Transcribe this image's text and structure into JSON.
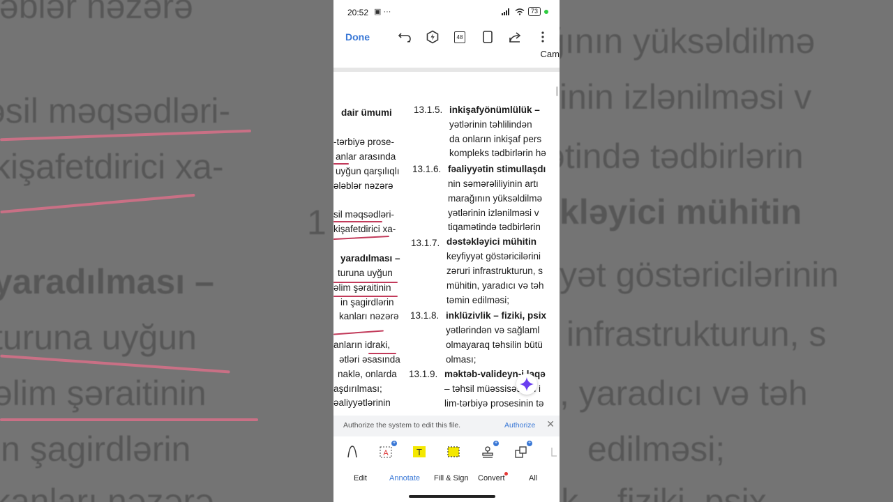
{
  "background": {
    "left_lines": [
      "ələblər nəzərə",
      "əsil məqsədləri-",
      "kişafetdirici xa-",
      "1",
      "yaradılması –",
      "turuna uyğun",
      "əlim şəraitinin",
      "in şagirdlərin",
      "kanları nəzərə"
    ],
    "right_lines": [
      "ğının yüksəldilmə",
      "inin izlənilməsi v",
      "ətində tədbirlərin",
      "kləyici mühitin",
      "yət göstəricilərinin",
      "infrastrukturun, s",
      ", yaradıcı və təh",
      "edilməsi;",
      "lik – fiziki, psix"
    ]
  },
  "status_bar": {
    "time": "20:52",
    "left_icons": "▣ ···",
    "battery": "73"
  },
  "toolbar": {
    "done_label": "Done",
    "pages": "48"
  },
  "document": {
    "top_fragment": "Cam",
    "left_column": [
      "dair ümumi",
      "-tərbiyə prose-",
      "anlar arasında",
      "uyğun qarşılıqlı",
      "ələblər nəzərə",
      "sil məqsədləri-",
      "kişafetdirici xa-",
      "yaradılması –",
      "turuna uyğun",
      "əlim şəraitinin",
      "in şagirdlərin",
      "kanları nəzərə",
      "anların idraki,",
      "ətləri əsasında",
      "naklə, onlarda",
      "aşdırılması;",
      "əaliyyətlərinin"
    ],
    "right_column": [
      {
        "num": "13.1.5.",
        "head": "inkişafyönümlülük –",
        "lines": [
          "yətlərinin təhlilindən",
          "da onların inkişaf pers",
          "kompleks tədbirlərin hə"
        ]
      },
      {
        "num": "13.1.6.",
        "head": "fəaliyyətin stimullaşdı",
        "lines": [
          "nin səmərəliliyinin artı",
          "marağının yüksəldilmə",
          "yətlərinin izlənilməsi v",
          "tiqamətində tədbirlərin"
        ]
      },
      {
        "num": "13.1.7.",
        "head": "dəstəkləyici mühitin",
        "lines": [
          "keyfiyyət göstəricilərini",
          "zəruri infrastrukturun, s",
          "mühitin, yaradıcı və təh",
          "təmin edilməsi;"
        ]
      },
      {
        "num": "13.1.8.",
        "head": "inklüzivlik – fiziki, psix",
        "lines": [
          "yətlərindən və sağlaml",
          "olmayaraq təhsilin bütü",
          "olması;"
        ]
      },
      {
        "num": "13.1.9.",
        "head": "məktəb-valideyn-i laqə",
        "lines": [
          "– təhsil müəssisəsinin i",
          "lim-tərbiyə prosesinin tə"
        ]
      }
    ]
  },
  "authorize": {
    "message": "Authorize the system to edit this file.",
    "button": "Authorize"
  },
  "tools": [
    "pen-tool",
    "text-box-tool",
    "text-tool",
    "area-highlight-tool",
    "stamp-tool",
    "shapes-tool"
  ],
  "tabs": {
    "edit": "Edit",
    "annotate": "Annotate",
    "fill_sign": "Fill & Sign",
    "convert": "Convert",
    "all": "All"
  },
  "colors": {
    "accent": "#3a78d6",
    "highlight_yellow": "#f4e800",
    "ink": "#c23a5a"
  }
}
